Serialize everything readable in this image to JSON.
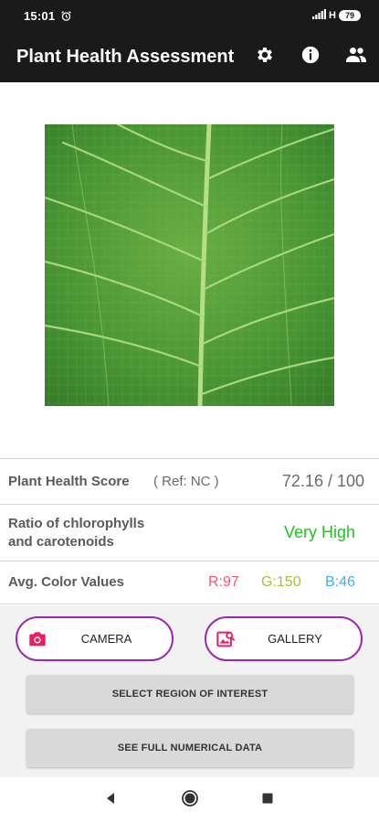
{
  "status_bar": {
    "time": "15:01",
    "network": "H",
    "battery": "79"
  },
  "app_bar": {
    "title": "Plant Health Assessment",
    "icons": [
      "settings-icon",
      "info-icon",
      "people-icon"
    ]
  },
  "image": {
    "icon": "leaf-photo"
  },
  "score_row": {
    "label": "Plant Health Score",
    "ref": "( Ref: NC )",
    "value": "72.16 / 100"
  },
  "ratio_row": {
    "label_line1": "Ratio of chlorophylls",
    "label_line2": "and carotenoids",
    "value": "Very High"
  },
  "color_row": {
    "label": "Avg. Color Values",
    "r": "R:97",
    "g": "G:150",
    "b": "B:46"
  },
  "buttons": {
    "camera": "CAMERA",
    "gallery": "GALLERY",
    "roi": "SELECT REGION OF INTEREST",
    "full_data": "SEE FULL NUMERICAL DATA"
  },
  "colors": {
    "accent": "#9c27b0",
    "icon_pink": "#e91e63",
    "ratio_green": "#1ec41e",
    "r_color": "#f05a6e",
    "g_color": "#a5c33a",
    "b_color": "#3fb3e6"
  },
  "nav": {
    "icons": [
      "back-icon",
      "home-icon",
      "recents-icon"
    ]
  }
}
